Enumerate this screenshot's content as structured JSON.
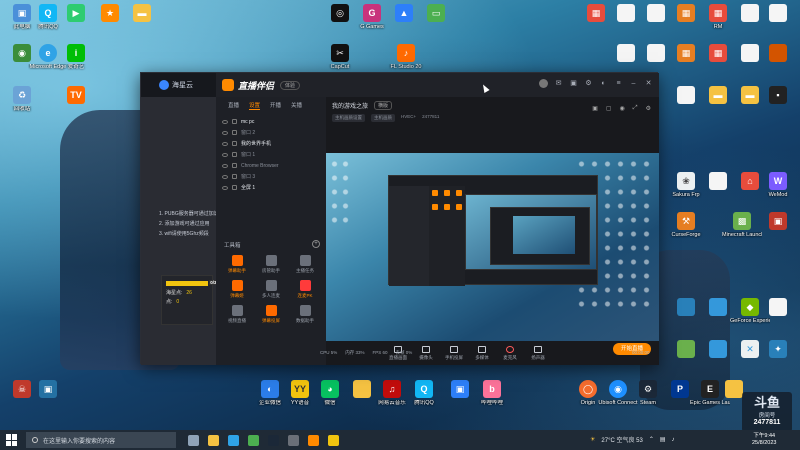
{
  "desktop": {
    "icons_left": [
      {
        "label": "此电脑",
        "color": "#4a90d9",
        "x_col": 0
      },
      {
        "label": "腾讯QQ",
        "color": "#12b7f5"
      },
      {
        "label": "Microsoft Edge",
        "color": "#2fa3e6"
      },
      {
        "label": "爱奇艺",
        "color": "#00be06"
      },
      {
        "label": "回收站",
        "color": "#6ba3d6"
      }
    ],
    "icons_top": [
      {
        "label": "",
        "color": "#1da1f2"
      },
      {
        "label": "",
        "color": "#e0336a"
      },
      {
        "label": "",
        "color": "#2d7ff9"
      },
      {
        "label": "",
        "color": "#4caf50"
      },
      {
        "label": "",
        "color": "#ff6a00"
      }
    ],
    "icons_top_labels": [
      "CapCut",
      "G Games",
      "ModelMaker",
      "FL Studio 20",
      "画质调节"
    ],
    "icons_right": [
      {
        "label": "网易云游戏",
        "color": "#e74c3c"
      },
      {
        "label": "暴风影音",
        "color": "#3498db"
      },
      {
        "label": "RM",
        "color": "#f1c40f"
      },
      {
        "label": "Sakura Frp",
        "color": "#ecf0f1"
      },
      {
        "label": "WeMod",
        "color": "#7b5cff"
      },
      {
        "label": "CurseForge",
        "color": "#e67e22"
      },
      {
        "label": "Minecraft Launcher",
        "color": "#6ab04c"
      },
      {
        "label": "GeForce Experience",
        "color": "#76b900"
      },
      {
        "label": "Ubisoft Connect",
        "color": "#1e90ff"
      },
      {
        "label": "Steam",
        "color": "#1b2838"
      },
      {
        "label": "Epic Games Launcher",
        "color": "#222222"
      }
    ],
    "icons_bottom": [
      {
        "label": "企业微信",
        "color": "#2b7de9"
      },
      {
        "label": "YY语音",
        "color": "#f1c40f"
      },
      {
        "label": "微信",
        "color": "#07c160"
      },
      {
        "label": "网易云音乐",
        "color": "#c20c0c"
      },
      {
        "label": "腾讯QQ",
        "color": "#12b7f5"
      },
      {
        "label": "哔哩哔哩",
        "color": "#fb7299"
      },
      {
        "label": "Origin",
        "color": "#f56c2d"
      },
      {
        "label": "Ubisoft Connect",
        "color": "#1e90ff"
      },
      {
        "label": "Steam",
        "color": "#1b2838"
      },
      {
        "label": "Epic Games Launcher",
        "color": "#222222"
      }
    ]
  },
  "app": {
    "left_brand": "海星云",
    "title": "直播伴侣",
    "version": "体验",
    "menu_tabs": [
      "直播",
      "设置",
      "开播",
      "关播"
    ],
    "devices": [
      {
        "label": "mc pc",
        "active": true
      },
      {
        "label": "窗口 2",
        "active": false
      },
      {
        "label": "我的世界手机",
        "active": true
      },
      {
        "label": "窗口 1",
        "active": false
      },
      {
        "label": "Chrome Browser",
        "active": false
      },
      {
        "label": "窗口 3",
        "active": false
      },
      {
        "label": "全屏 1",
        "active": true
      }
    ],
    "tools_title": "工具箱",
    "tools": [
      {
        "label": "弹幕助手",
        "hot": true,
        "color": "#ff6a00"
      },
      {
        "label": "房管助手",
        "hot": false,
        "color": "#9aa0aa"
      },
      {
        "label": "主播任务",
        "hot": false,
        "color": "#9aa0aa"
      },
      {
        "label": "弹幕姬",
        "hot": true,
        "color": "#ff6a00"
      },
      {
        "label": "多人连麦",
        "hot": false,
        "color": "#9aa0aa"
      },
      {
        "label": "连麦PK",
        "hot": true,
        "color": "#ff6a00"
      },
      {
        "label": "视频直播",
        "hot": false,
        "color": "#9aa0aa"
      },
      {
        "label": "弹幕投屏",
        "hot": true,
        "color": "#ff6a00"
      },
      {
        "label": "数据助手",
        "hot": false,
        "color": "#9aa0aa"
      }
    ],
    "bullets": [
      "1. PUBG服务器可通过加速器",
      "2. 添加游戏可通过应用",
      "3. wifi请使用5Ghz频段"
    ],
    "promo_score_label": "海星点:",
    "promo_score": "26",
    "promo_score2": "0",
    "preview_title": "我的游戏之旅",
    "preview_tag": "横版",
    "preview_subs": [
      "主机画质设置",
      "主机画质",
      "HVEC+"
    ],
    "room_id": "2477811",
    "controls": [
      "直播画面",
      "摄像头",
      "手机投屏",
      "多媒体",
      "麦克风",
      "扬声器"
    ],
    "go_live": "开始直播",
    "stats": [
      "CPU 5%",
      "内存 33%",
      "FPS 60",
      "丢帧 0%"
    ],
    "time": "00:00:00"
  },
  "watermark": {
    "logo": "斗鱼",
    "room_label": "房间号",
    "room_number": "2477811"
  },
  "taskbar": {
    "search_placeholder": "在这里输入你要搜索的内容",
    "weather": "27°C 空气良 53",
    "time": "下午9:44",
    "date": "25/8/2023"
  }
}
